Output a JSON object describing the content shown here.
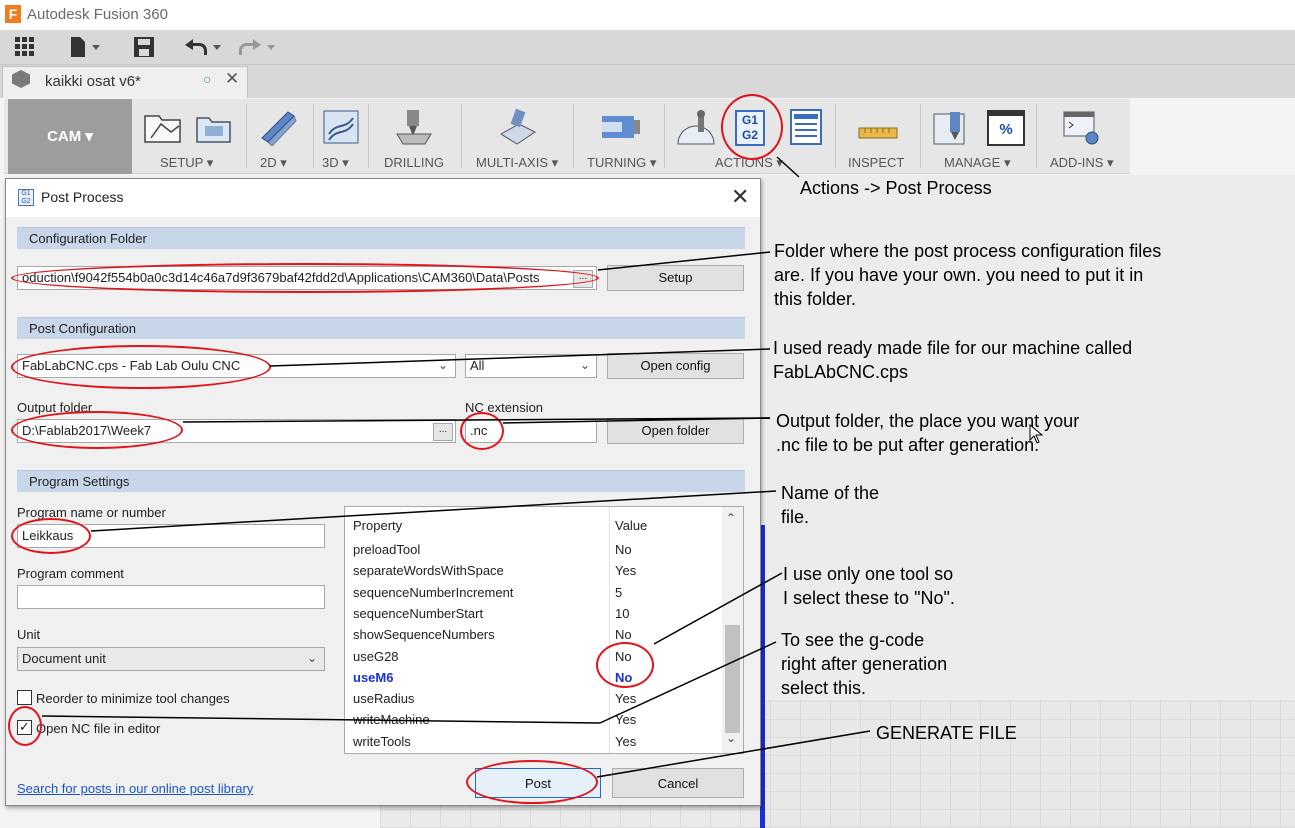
{
  "app": {
    "title": "Autodesk Fusion 360",
    "logo_letter": "F"
  },
  "document_tab": {
    "name": "kaikki osat v6*"
  },
  "toolbar": {
    "workspace": "CAM ▾",
    "groups": [
      {
        "label": "SETUP ▾"
      },
      {
        "label": "2D ▾"
      },
      {
        "label": "3D ▾"
      },
      {
        "label": "DRILLING"
      },
      {
        "label": "MULTI-AXIS ▾"
      },
      {
        "label": "TURNING ▾"
      },
      {
        "label": "ACTIONS ▾"
      },
      {
        "label": "INSPECT"
      },
      {
        "label": "MANAGE ▾"
      },
      {
        "label": "ADD-INS ▾"
      }
    ],
    "g1g2_line1": "G1",
    "g1g2_line2": "G2",
    "manage_pct": "%"
  },
  "dialog": {
    "title": "Post Process",
    "config_folder": {
      "header": "Configuration Folder",
      "path": "oduction\\f9042f554b0a0c3d14c46a7d9f3679baf42fdd2d\\Applications\\CAM360\\Data\\Posts",
      "browse": "...",
      "setup_button": "Setup"
    },
    "post_config": {
      "header": "Post Configuration",
      "selected": "FabLabCNC.cps - Fab Lab Oulu CNC",
      "filter": "All",
      "open_config_button": "Open config"
    },
    "output": {
      "folder_label": "Output folder",
      "folder_value": "D:\\Fablab2017\\Week7",
      "browse": "...",
      "nc_ext_label": "NC extension",
      "nc_ext_value": ".nc",
      "open_folder_button": "Open folder"
    },
    "program": {
      "header": "Program Settings",
      "name_label": "Program name or number",
      "name_value": "Leikkaus",
      "comment_label": "Program comment",
      "comment_value": "",
      "unit_label": "Unit",
      "unit_value": "Document unit",
      "reorder_label": "Reorder to minimize tool changes",
      "reorder_checked": false,
      "open_nc_label": "Open NC file in editor",
      "open_nc_checked": true
    },
    "properties": {
      "col_property": "Property",
      "col_value": "Value",
      "rows": [
        {
          "name": "preloadTool",
          "value": "No",
          "bold": false
        },
        {
          "name": "separateWordsWithSpace",
          "value": "Yes",
          "bold": false
        },
        {
          "name": "sequenceNumberIncrement",
          "value": "5",
          "bold": false
        },
        {
          "name": "sequenceNumberStart",
          "value": "10",
          "bold": false
        },
        {
          "name": "showSequenceNumbers",
          "value": "No",
          "bold": false
        },
        {
          "name": "useG28",
          "value": "No",
          "bold": false
        },
        {
          "name": "useM6",
          "value": "No",
          "bold": true
        },
        {
          "name": "useRadius",
          "value": "Yes",
          "bold": false
        },
        {
          "name": "writeMachine",
          "value": "Yes",
          "bold": false
        },
        {
          "name": "writeTools",
          "value": "Yes",
          "bold": false
        }
      ]
    },
    "link": "Search for posts in our online post library",
    "post_button": "Post",
    "cancel_button": "Cancel"
  },
  "annotations": {
    "actions": "Actions -> Post Process",
    "folder": [
      "Folder where the post process configuration files",
      "are. If you have your own. you need to put it in",
      "this folder."
    ],
    "config": [
      "I used ready made file for our machine called",
      "FabLAbCNC.cps"
    ],
    "output": [
      "Output folder, the place you want your",
      ".nc file to be put after generation."
    ],
    "name": [
      "Name of the",
      "file."
    ],
    "tool": [
      "I use only one tool so",
      "I select these to \"No\"."
    ],
    "gcode": [
      "To see the g-code",
      "right after generation",
      "select this."
    ],
    "generate": "GENERATE FILE"
  },
  "colors": {
    "annotation_red": "#e0141b",
    "section_blue": "#c8d6ea",
    "link_blue": "#1a56c8",
    "highlight_blue": "#1a2fd6"
  }
}
